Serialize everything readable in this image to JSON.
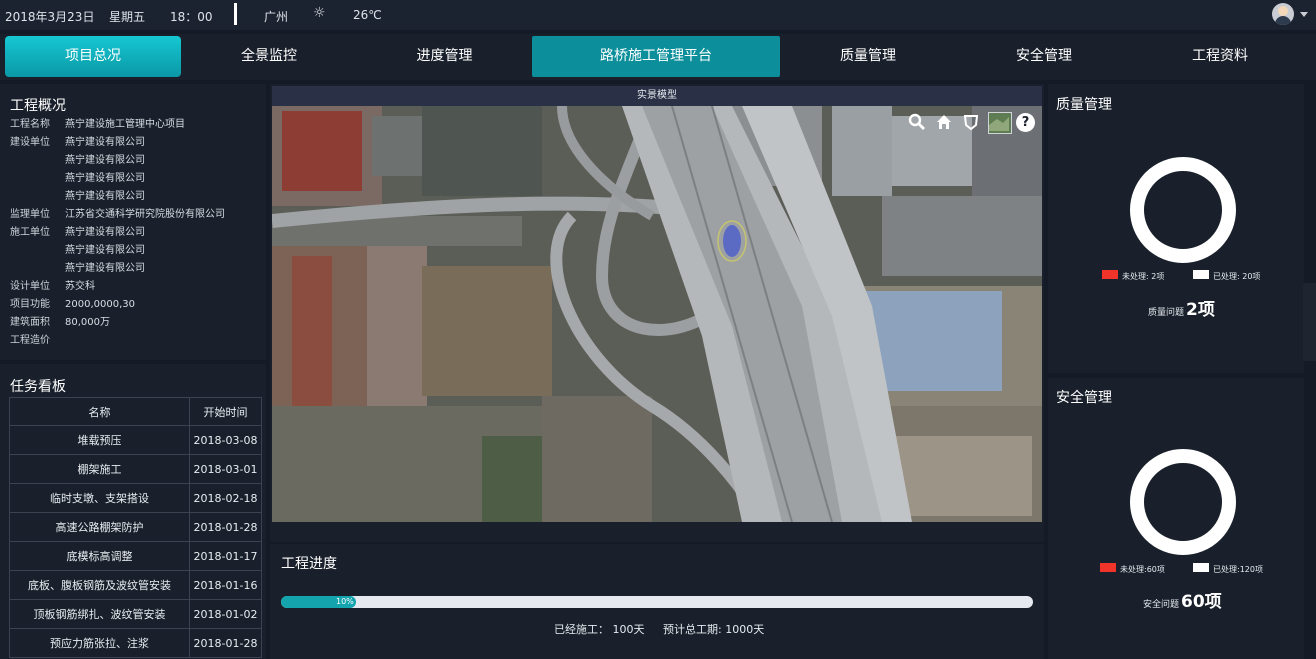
{
  "topbar": {
    "date": "2018年3月23日",
    "weekday": "星期五",
    "time": "18：00",
    "city": "广州",
    "weather_icon": "sun-icon",
    "temperature": "26℃"
  },
  "nav": {
    "items": [
      "项目总况",
      "全景监控",
      "进度管理",
      "路桥施工管理平台",
      "质量管理",
      "安全管理",
      "工程资料"
    ]
  },
  "overview": {
    "title": "工程概况",
    "rows": [
      {
        "label": "工程名称",
        "value": "燕宁建设施工管理中心项目"
      },
      {
        "label": "建设单位",
        "value": "燕宁建设有限公司"
      },
      {
        "label": "",
        "value": "燕宁建设有限公司"
      },
      {
        "label": "",
        "value": "燕宁建设有限公司"
      },
      {
        "label": "",
        "value": "燕宁建设有限公司"
      },
      {
        "label": "监理单位",
        "value": "江苏省交通科学研究院股份有限公司"
      },
      {
        "label": "施工单位",
        "value": "燕宁建设有限公司"
      },
      {
        "label": "",
        "value": "燕宁建设有限公司"
      },
      {
        "label": "",
        "value": "燕宁建设有限公司"
      },
      {
        "label": "设计单位",
        "value": "苏交科"
      },
      {
        "label": "项目功能",
        "value": "2000,0000,30"
      },
      {
        "label": "建筑面积",
        "value": "80,000万"
      },
      {
        "label": "工程造价",
        "value": ""
      }
    ]
  },
  "tasks": {
    "title": "任务看板",
    "columns": [
      "名称",
      "开始时间"
    ],
    "rows": [
      [
        "堆载预压",
        "2018-03-08"
      ],
      [
        "棚架施工",
        "2018-03-01"
      ],
      [
        "临时支墩、支架搭设",
        "2018-02-18"
      ],
      [
        "高速公路棚架防护",
        "2018-01-28"
      ],
      [
        "底模标高调整",
        "2018-01-17"
      ],
      [
        "底板、腹板钢筋及波纹管安装",
        "2018-01-16"
      ],
      [
        "顶板钢筋绑扎、波纹管安装",
        "2018-01-02"
      ],
      [
        "预应力筋张拉、注浆",
        "2018-01-28"
      ]
    ]
  },
  "map": {
    "title": "实景模型",
    "tools": [
      "search-icon",
      "home-icon",
      "shield-icon",
      "layer-thumbnail-icon",
      "help-icon"
    ],
    "help_glyph": "?"
  },
  "progress": {
    "title": "工程进度",
    "percent": 10,
    "percent_label": "10%",
    "elapsed": "已经施工： 100天",
    "total": "预计总工期: 1000天"
  },
  "quality": {
    "title": "质量管理",
    "unprocessed_label": "未处理: 2项",
    "processed_label": "已处理: 20项",
    "unprocessed": 2,
    "processed": 20,
    "summary_label": "质量问题",
    "summary_value": "2项",
    "colors": {
      "unprocessed": "#f0342a",
      "processed": "#ffffff"
    }
  },
  "safety": {
    "title": "安全管理",
    "unprocessed_label": "未处理:60项",
    "processed_label": "已处理:120项",
    "unprocessed": 60,
    "processed": 120,
    "summary_label": "安全问题",
    "summary_value": "60项",
    "colors": {
      "unprocessed": "#f0342a",
      "processed": "#ffffff"
    }
  },
  "colors": {
    "accent": "#0fb4c0",
    "background": "#141b26",
    "panel": "#19202b"
  }
}
